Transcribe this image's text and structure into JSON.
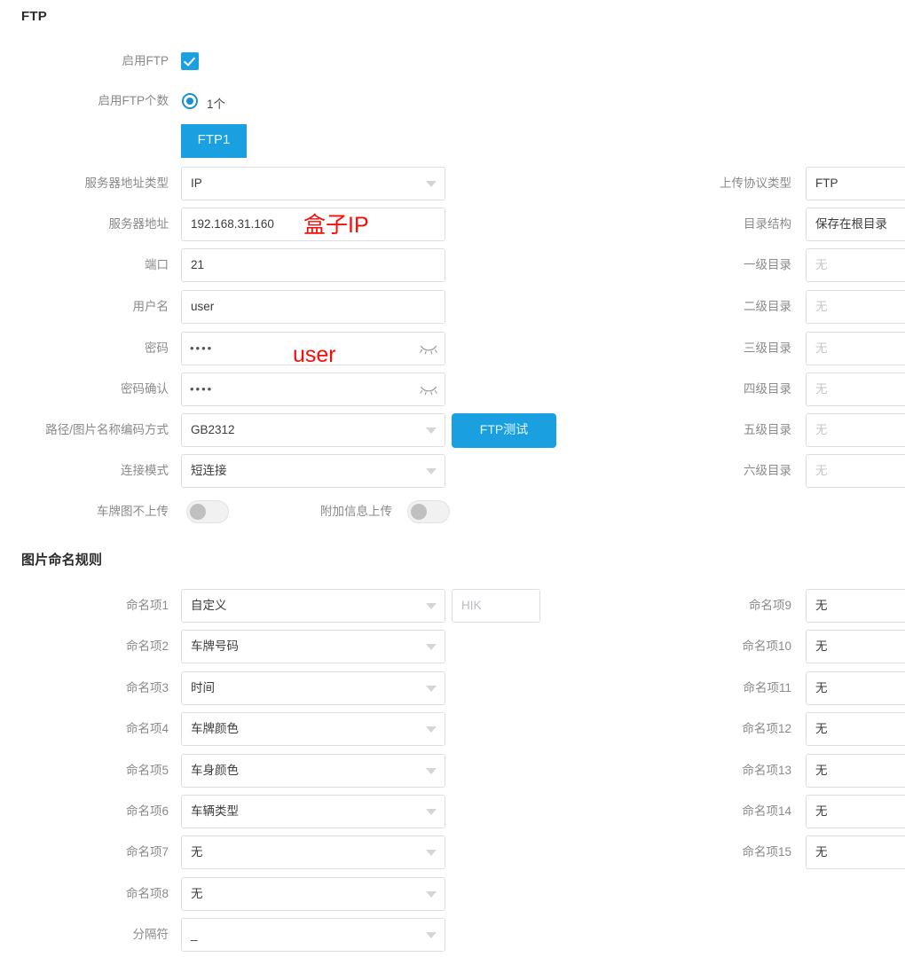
{
  "sections": {
    "ftp": {
      "title": "FTP"
    },
    "naming": {
      "title": "图片命名规则"
    }
  },
  "ftp": {
    "enable": {
      "label": "启用FTP",
      "checked": true
    },
    "count": {
      "label": "启用FTP个数",
      "option_label": "1个",
      "selected": true
    },
    "tab": {
      "label": "FTP1",
      "active": true
    },
    "left_fields": [
      {
        "label": "服务器地址类型",
        "value": "IP",
        "type": "select"
      },
      {
        "label": "服务器地址",
        "value": "192.168.31.160",
        "type": "text"
      },
      {
        "label": "端口",
        "value": "21",
        "type": "text"
      },
      {
        "label": "用户名",
        "value": "user",
        "type": "text"
      },
      {
        "label": "密码",
        "value": "••••",
        "type": "password"
      },
      {
        "label": "密码确认",
        "value": "••••",
        "type": "password"
      },
      {
        "label": "路径/图片名称编码方式",
        "value": "GB2312",
        "type": "select"
      },
      {
        "label": "连接模式",
        "value": "短连接",
        "type": "select"
      }
    ],
    "test_button": {
      "label": "FTP测试"
    },
    "toggles": [
      {
        "label": "车牌图不上传",
        "on": false
      },
      {
        "label": "附加信息上传",
        "on": false
      }
    ],
    "right_fields": [
      {
        "label": "上传协议类型",
        "value": "FTP",
        "placeholder": false
      },
      {
        "label": "目录结构",
        "value": "保存在根目录",
        "placeholder": false
      },
      {
        "label": "一级目录",
        "value": "无",
        "placeholder": true
      },
      {
        "label": "二级目录",
        "value": "无",
        "placeholder": true
      },
      {
        "label": "三级目录",
        "value": "无",
        "placeholder": true
      },
      {
        "label": "四级目录",
        "value": "无",
        "placeholder": true
      },
      {
        "label": "五级目录",
        "value": "无",
        "placeholder": true
      },
      {
        "label": "六级目录",
        "value": "无",
        "placeholder": true
      }
    ]
  },
  "naming": {
    "left_items": [
      {
        "label": "命名项1",
        "value": "自定义"
      },
      {
        "label": "命名项2",
        "value": "车牌号码"
      },
      {
        "label": "命名项3",
        "value": "时间"
      },
      {
        "label": "命名项4",
        "value": "车牌颜色"
      },
      {
        "label": "命名项5",
        "value": "车身颜色"
      },
      {
        "label": "命名项6",
        "value": "车辆类型"
      },
      {
        "label": "命名项7",
        "value": "无"
      },
      {
        "label": "命名项8",
        "value": "无"
      }
    ],
    "custom_value": {
      "value": "HIK"
    },
    "separator": {
      "label": "分隔符",
      "value": "_"
    },
    "right_items": [
      {
        "label": "命名项9",
        "value": "无"
      },
      {
        "label": "命名项10",
        "value": "无"
      },
      {
        "label": "命名项11",
        "value": "无"
      },
      {
        "label": "命名项12",
        "value": "无"
      },
      {
        "label": "命名项13",
        "value": "无"
      },
      {
        "label": "命名项14",
        "value": "无"
      },
      {
        "label": "命名项15",
        "value": "无"
      }
    ]
  },
  "annotations": [
    {
      "text": "盒子IP",
      "color": "#fb0b06"
    },
    {
      "text": "user",
      "color": "#fb0b06"
    }
  ],
  "colors": {
    "accent": "#1aa0e0",
    "checkbox": "#1ba1e2",
    "radio": "#1b8fd0",
    "annotation": "#fb0b06",
    "label": "#8a8a8a",
    "border": "#dcdee2"
  },
  "icons": {
    "caret": "chevron-down-icon",
    "eye": "eye-off-icon",
    "check": "check-icon"
  }
}
